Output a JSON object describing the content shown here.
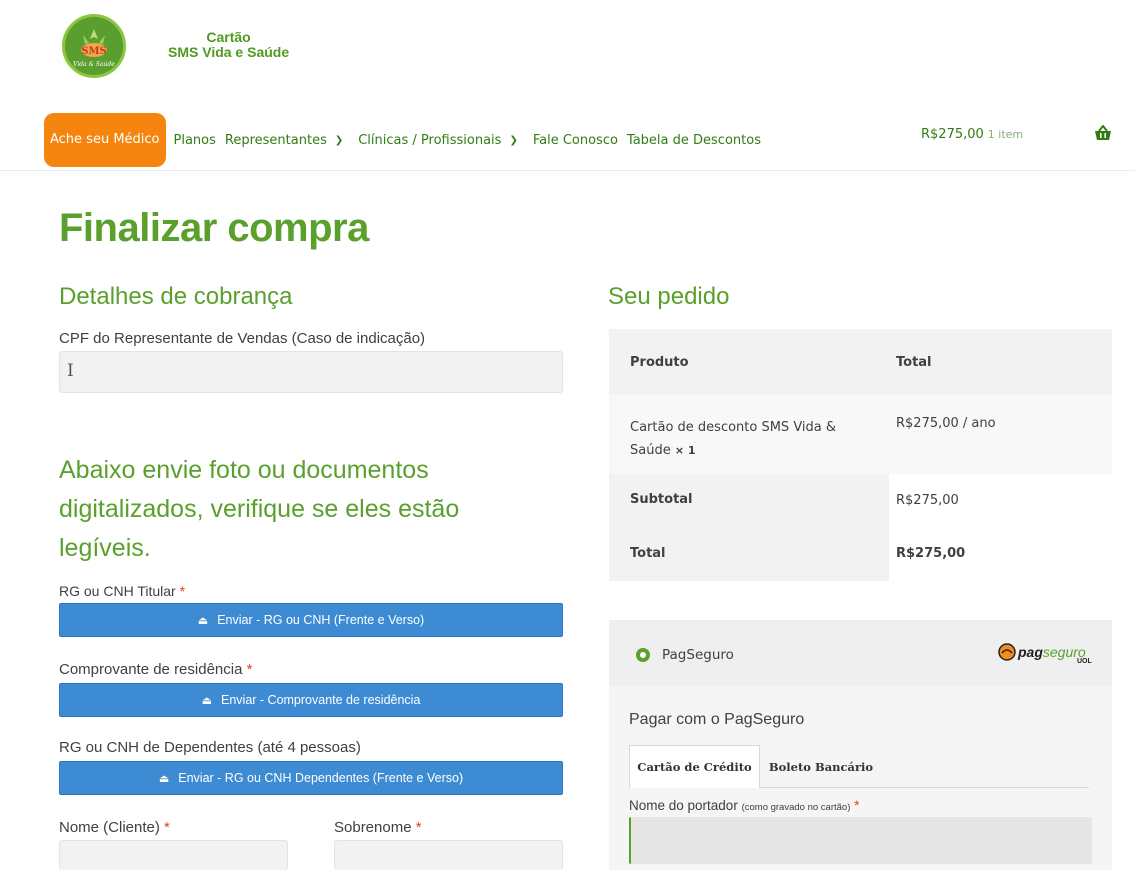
{
  "header": {
    "brand_line1": "Cartão",
    "brand_line2": "SMS Vida e Saúde",
    "logo_text": "SMS",
    "logo_subtext": "Vida & Saúde",
    "nav": [
      {
        "label": "Ache seu Médico",
        "active": true
      },
      {
        "label": "Planos"
      },
      {
        "label": "Representantes",
        "has_dropdown": true
      },
      {
        "label": "Clínicas / Profissionais",
        "has_dropdown": true
      },
      {
        "label": "Fale Conosco"
      },
      {
        "label": "Tabela de Descontos"
      }
    ],
    "cart": {
      "total": "R$275,00",
      "count": "1 item",
      "icon": "basket-icon"
    }
  },
  "page": {
    "title": "Finalizar compra",
    "billing": {
      "heading": "Detalhes de cobrança",
      "cpf_label": "CPF do Representante de Vendas (Caso de indicação)",
      "cpf_value": "",
      "upload_heading": "Abaixo envie foto ou documentos digitalizados, verifique se eles estão legíveis.",
      "rg_label": "RG ou CNH Titular",
      "rg_button": "Enviar - RG ou CNH (Frente e Verso)",
      "residence_label": "Comprovante de residência",
      "residence_button": "Enviar - Comprovante de residência",
      "dependents_label": "RG ou CNH de Dependentes (até 4 pessoas)",
      "dependents_button": "Enviar - RG ou CNH Dependentes (Frente e Verso)",
      "first_name_label": "Nome (Cliente)",
      "last_name_label": "Sobrenome",
      "required_marker": "*",
      "upload_icon": "upload-icon"
    },
    "order": {
      "heading": "Seu pedido",
      "col_product": "Produto",
      "col_total": "Total",
      "item_name": "Cartão de desconto SMS Vida & Saúde",
      "item_qty": "× 1",
      "item_price": "R$275,00 / ano",
      "subtotal_label": "Subtotal",
      "subtotal_value": "R$275,00",
      "total_label": "Total",
      "total_value": "R$275,00"
    },
    "payment": {
      "method_label": "PagSeguro",
      "logo_text_bold": "pag",
      "logo_text_light": "seguro",
      "logo_sub": "UOL",
      "title": "Pagar com o PagSeguro",
      "tabs": [
        {
          "label": "Cartão de Crédito",
          "active": true
        },
        {
          "label": "Boleto Bancário"
        }
      ],
      "holder_label": "Nome do portador",
      "holder_hint": "(como gravado no cartão)",
      "holder_value": ""
    }
  },
  "colors": {
    "brand_green": "#5aa02c",
    "nav_active": "#f5850f",
    "button_blue": "#3d8bd3",
    "required_red": "#e2401c"
  }
}
